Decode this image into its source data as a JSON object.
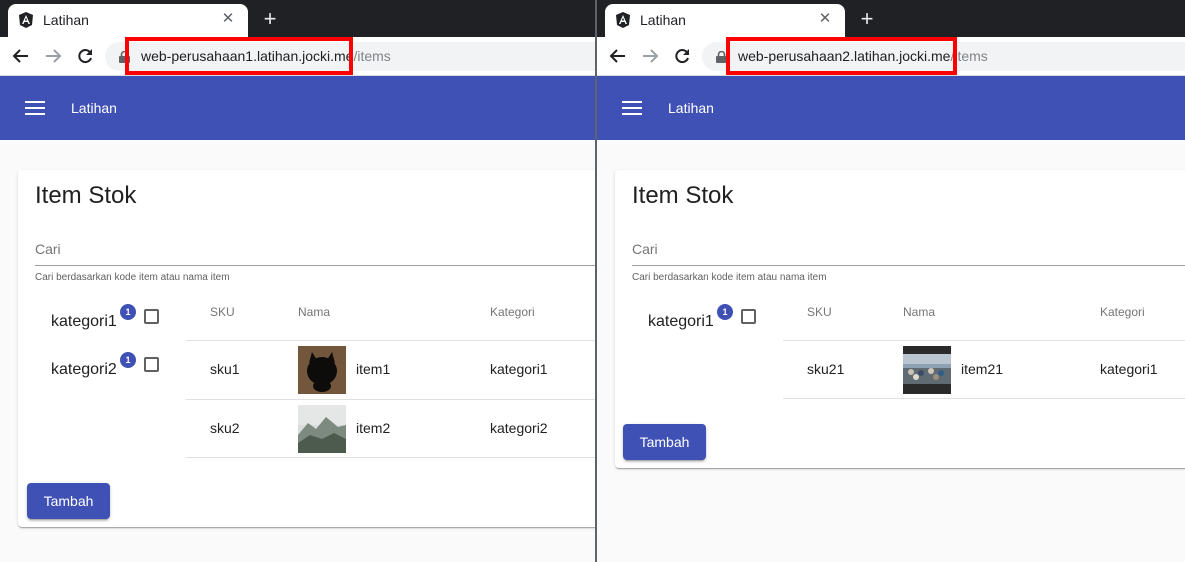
{
  "windows": [
    {
      "tab": {
        "title": "Latihan"
      },
      "address": {
        "host": "web-perusahaan1.latihan.jocki.me",
        "path": "/items"
      },
      "app": {
        "title": "Latihan"
      },
      "card": {
        "title": "Item Stok",
        "search": {
          "placeholder": "Cari",
          "hint": "Cari berdasarkan kode item atau nama item"
        },
        "categories": [
          {
            "label": "kategori1",
            "badge": "1"
          },
          {
            "label": "kategori2",
            "badge": "1"
          }
        ],
        "table": {
          "headers": [
            "SKU",
            "Nama",
            "Kategori"
          ],
          "rows": [
            {
              "sku": "sku1",
              "nama": "item1",
              "kategori": "kategori1",
              "thumb_icon": "dark-cat-photo"
            },
            {
              "sku": "sku2",
              "nama": "item2",
              "kategori": "kategori2",
              "thumb_icon": "misty-mountain-photo"
            }
          ]
        },
        "add_button": "Tambah"
      }
    },
    {
      "tab": {
        "title": "Latihan"
      },
      "address": {
        "host": "web-perusahaan2.latihan.jocki.me",
        "path": "/items"
      },
      "app": {
        "title": "Latihan"
      },
      "card": {
        "title": "Item Stok",
        "search": {
          "placeholder": "Cari",
          "hint": "Cari berdasarkan kode item atau nama item"
        },
        "categories": [
          {
            "label": "kategori1",
            "badge": "1"
          }
        ],
        "table": {
          "headers": [
            "SKU",
            "Nama",
            "Kategori"
          ],
          "rows": [
            {
              "sku": "sku21",
              "nama": "item21",
              "kategori": "kategori1",
              "thumb_icon": "crowd-street-photo"
            }
          ]
        },
        "add_button": "Tambah"
      }
    }
  ],
  "colors": {
    "primary": "#3f51b5",
    "highlight": "#ff0000",
    "tabstrip": "#202124"
  }
}
